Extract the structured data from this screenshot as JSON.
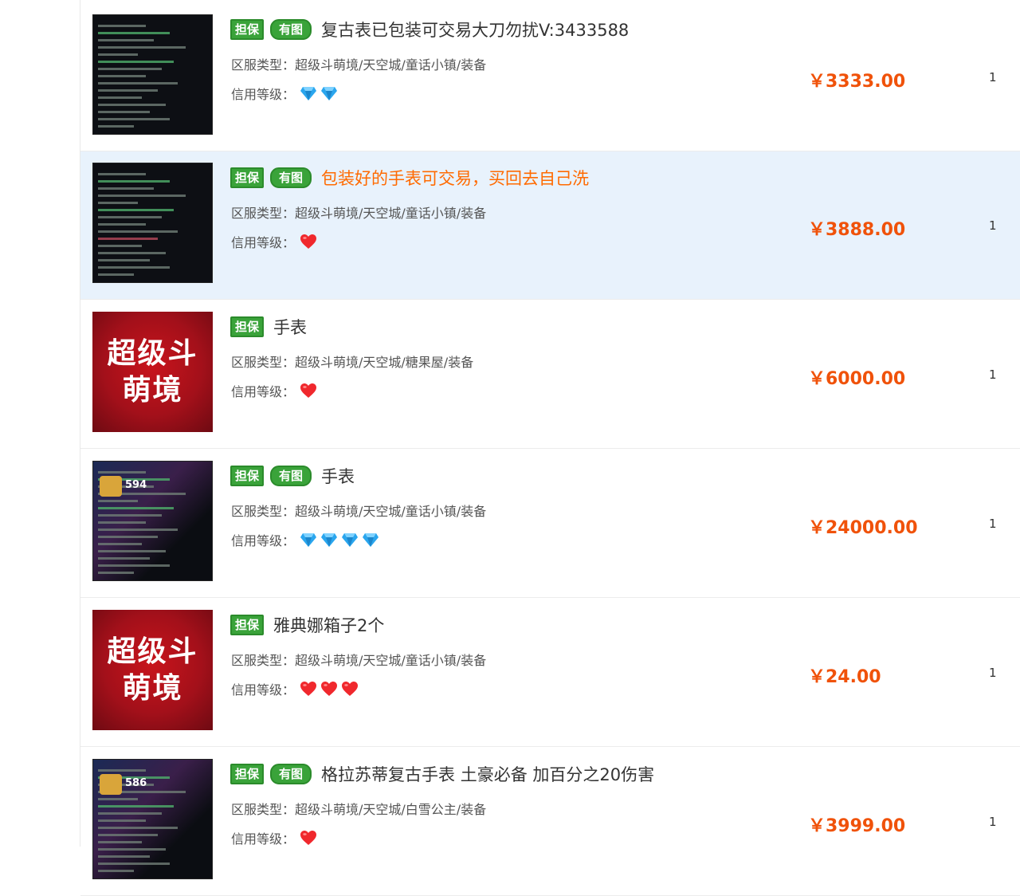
{
  "tags": {
    "dan": "担保",
    "you": "有图"
  },
  "labels": {
    "type_prefix": "区服类型：",
    "credit_prefix": "信用等级："
  },
  "listings": [
    {
      "title": "复古表已包装可交易大刀勿扰V:3433588",
      "has_image_tag": true,
      "type": "超级斗萌境/天空城/童话小镇/装备",
      "credit_icon": "diamond",
      "credit_count": 2,
      "price": "￥3333.00",
      "qty": "1",
      "thumb": "screenshot"
    },
    {
      "title": "包装好的手表可交易，买回去自己洗",
      "has_image_tag": true,
      "highlight": true,
      "type": "超级斗萌境/天空城/童话小镇/装备",
      "credit_icon": "heart",
      "credit_count": 1,
      "price": "￥3888.00",
      "qty": "1",
      "thumb": "screenshot"
    },
    {
      "title": "手表",
      "has_image_tag": false,
      "type": "超级斗萌境/天空城/糖果屋/装备",
      "credit_icon": "heart",
      "credit_count": 1,
      "price": "￥6000.00",
      "qty": "1",
      "thumb": "logo",
      "logo_line1": "超级斗",
      "logo_line2": "萌境"
    },
    {
      "title": "手表",
      "has_image_tag": true,
      "type": "超级斗萌境/天空城/童话小镇/装备",
      "credit_icon": "diamond",
      "credit_count": 4,
      "price": "￥24000.00",
      "qty": "1",
      "thumb": "screenshot-purple",
      "thumb_badge": "594"
    },
    {
      "title": "雅典娜箱子2个",
      "has_image_tag": false,
      "type": "超级斗萌境/天空城/童话小镇/装备",
      "credit_icon": "heart",
      "credit_count": 3,
      "price": "￥24.00",
      "qty": "1",
      "thumb": "logo",
      "logo_line1": "超级斗",
      "logo_line2": "萌境"
    },
    {
      "title": "格拉苏蒂复古手表 土豪必备 加百分之20伤害",
      "has_image_tag": true,
      "type": "超级斗萌境/天空城/白雪公主/装备",
      "credit_icon": "heart",
      "credit_count": 1,
      "price": "￥3999.00",
      "qty": "1",
      "thumb": "screenshot-purple",
      "thumb_badge": "586"
    }
  ],
  "colors": {
    "tag_green": "#3aa33a",
    "price_orange": "#f0520a",
    "title_orange": "#ff6a00",
    "highlight_bg": "#e8f2fc",
    "diamond_blue": "#2aa6ee",
    "heart_red": "#f0282d",
    "logo_red": "#b0101a"
  }
}
